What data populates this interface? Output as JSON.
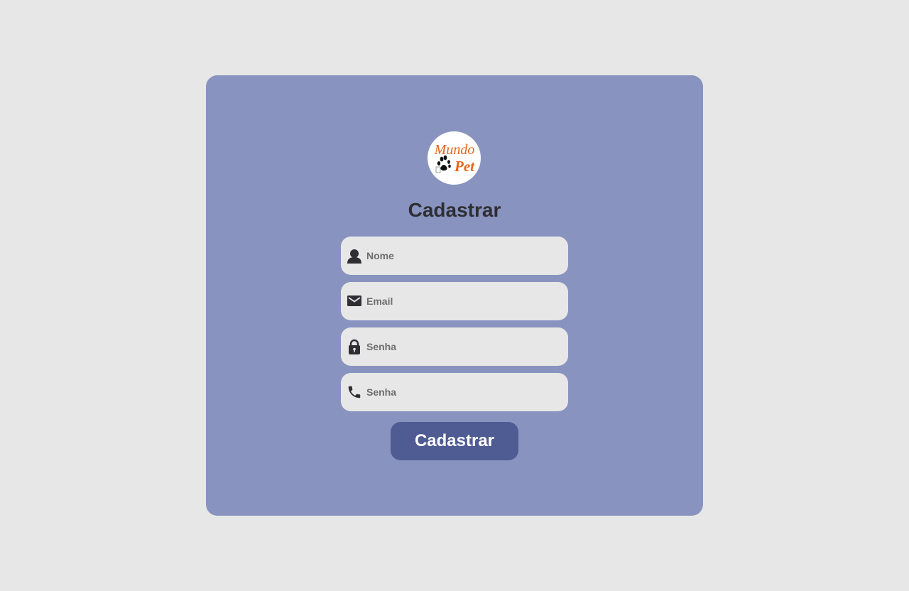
{
  "logo": {
    "line1": "Mundo",
    "line2": "Pet"
  },
  "form": {
    "title": "Cadastrar",
    "fields": [
      {
        "icon": "user-icon",
        "placeholder": "Nome",
        "value": ""
      },
      {
        "icon": "envelope-icon",
        "placeholder": "Email",
        "value": ""
      },
      {
        "icon": "lock-icon",
        "placeholder": "Senha",
        "value": ""
      },
      {
        "icon": "phone-icon",
        "placeholder": "Senha",
        "value": ""
      }
    ],
    "submit_label": "Cadastrar"
  },
  "colors": {
    "background": "#e7e7e7",
    "card": "#8893bf",
    "button": "#4f5b93",
    "logo_text": "#e8641c"
  }
}
